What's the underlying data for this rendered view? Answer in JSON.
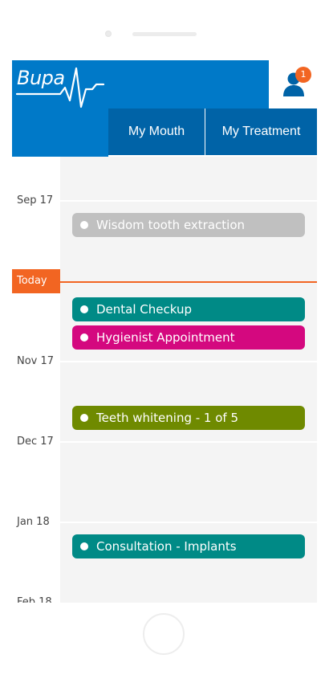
{
  "brand": {
    "logo_text": "Bupa",
    "primary_color": "#0079c8",
    "tab_color": "#0063a7",
    "accent_color": "#f26522"
  },
  "header": {
    "profile_icon": "user-icon",
    "notification_count": "1"
  },
  "tabs": [
    {
      "label": "My Mouth"
    },
    {
      "label": "My Treatment"
    }
  ],
  "timeline": {
    "today_label": "Today",
    "months": [
      {
        "label": "Sep 17"
      },
      {
        "label": "Nov 17"
      },
      {
        "label": "Dec 17"
      },
      {
        "label": "Jan 18"
      },
      {
        "label": "Feb 18"
      }
    ],
    "events": [
      {
        "label": "Wisdom tooth extraction",
        "color": "#c0c0c0"
      },
      {
        "label": "Dental Checkup",
        "color": "#008a86"
      },
      {
        "label": "Hygienist Appointment",
        "color": "#d4087f"
      },
      {
        "label": "Teeth whitening - 1 of 5",
        "color": "#6f8a00"
      },
      {
        "label": "Consultation - Implants",
        "color": "#008a86"
      }
    ]
  }
}
